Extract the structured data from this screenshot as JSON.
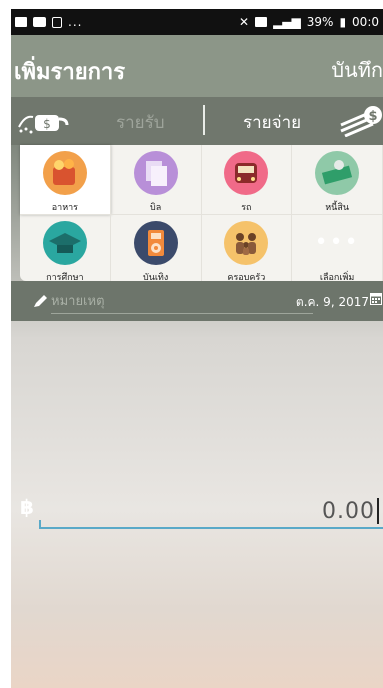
{
  "status_bar": {
    "left_dots": "...",
    "battery": "39%",
    "time": "00:0"
  },
  "header": {
    "title": "เพิ่มรายการ",
    "save_label": "บันทึก"
  },
  "type_tabs": {
    "income": "รายรับ",
    "expense": "รายจ่าย",
    "income_icon": "watering-can-icon",
    "expense_icon": "money-stack-icon"
  },
  "categories": [
    {
      "label": "อาหาร",
      "icon": "food-icon",
      "color": "#f2a04a",
      "selected": true
    },
    {
      "label": "บิล",
      "icon": "bill-icon",
      "color": "#b88fd8"
    },
    {
      "label": "รถ",
      "icon": "car-icon",
      "color": "#f06a88"
    },
    {
      "label": "หนี้สิน",
      "icon": "debt-icon",
      "color": "#8fc9a8"
    },
    {
      "label": "การศึกษา",
      "icon": "graduation-cap-icon",
      "color": "#2aa7a0"
    },
    {
      "label": "บันเทิง",
      "icon": "music-player-icon",
      "color": "#3b4a6b"
    },
    {
      "label": "ครอบครัว",
      "icon": "family-icon",
      "color": "#f5c26a"
    },
    {
      "label": "เลือกเพิ่ม",
      "icon": "more-icon",
      "color": "#ffffff"
    }
  ],
  "note": {
    "placeholder": "หมายเหตุ",
    "date": "ต.ค. 9, 2017"
  },
  "amount": {
    "currency_symbol": "฿",
    "value": "0.00"
  }
}
